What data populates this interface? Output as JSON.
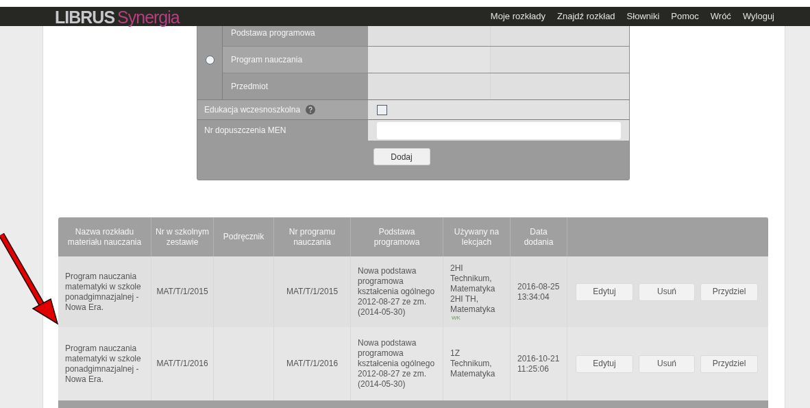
{
  "header": {
    "logo": {
      "part_1": "LIBRUS",
      "part_2": "Synergia"
    },
    "nav": [
      "Moje rozkłady",
      "Znajdź rozkład",
      "Słowniki",
      "Pomoc",
      "Wróć",
      "Wyloguj"
    ]
  },
  "form": {
    "choice": {
      "selected": false,
      "options": [
        "Podstawa programowa",
        "Program nauczania",
        "Przedmiot"
      ]
    },
    "early_education": {
      "label": "Edukacja wczesnoszkolna",
      "checked": false
    },
    "approval_number": {
      "label": "Nr dopuszczenia MEN"
    },
    "submit": "Dodaj"
  },
  "table": {
    "columns": [
      "Nazwa rozkładu materiału nauczania",
      "Nr w szkolnym zestawie",
      "Podręcznik",
      "Nr programu nauczania",
      "Podstawa programowa",
      "Używany na lekcjach",
      "Data dodania"
    ],
    "rows": [
      {
        "name": "Program nauczania matematyki w szkole ponadgimnazjalnej - Nowa Era.",
        "school_no": "MAT/T/1/2015",
        "program_no": "MAT/T/1/2015",
        "core": "Nowa podstawa programowa kształcenia ogólnego 2012-08-27 ze zm.(2014-05-30)",
        "used": [
          "2HI Technikum, Matematyka",
          "2HI TH, Matematyka"
        ],
        "tag": "WK",
        "added": "2016-08-25 13:34:04",
        "actions": [
          "Edytuj",
          "Usuń",
          "Przydziel"
        ]
      },
      {
        "name": "Program nauczania matematyki w szkole ponadgimnazjalnej - Nowa Era.",
        "school_no": "MAT/T/1/2016",
        "program_no": "MAT/T/1/2016",
        "core": "Nowa podstawa programowa kształcenia ogólnego 2012-08-27 ze zm.(2014-05-30)",
        "used": [
          "1Z Technikum, Matematyka"
        ],
        "added": "2016-10-21 11:25:06",
        "actions": [
          "Edytuj",
          "Usuń",
          "Przydziel"
        ]
      }
    ]
  }
}
